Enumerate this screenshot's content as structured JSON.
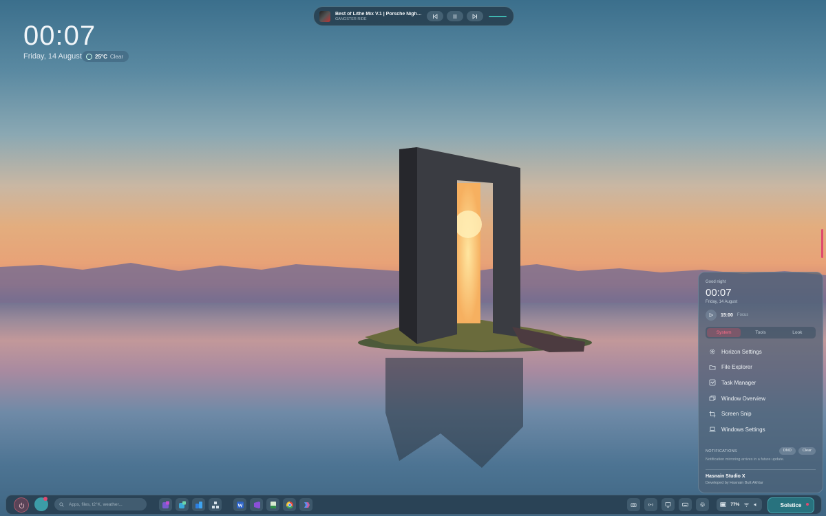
{
  "desktop": {
    "clock": "00:07",
    "date": "Friday, 14 August",
    "weather": {
      "temp": "25°C",
      "condition": "Clear"
    }
  },
  "media": {
    "title": "Best of Lithe Mix V.1 | Porsche Night R...",
    "artist": "GANGSTER RIDE",
    "controls": {
      "prev_icon": "skip-back-icon",
      "play_icon": "pause-icon",
      "next_icon": "skip-forward-icon"
    }
  },
  "panel": {
    "greeting": "Good night",
    "clock": "00:07",
    "date": "Friday, 14 August",
    "focus": {
      "time": "15:00",
      "label": "Focus"
    },
    "tabs": [
      {
        "label": "System",
        "active": true
      },
      {
        "label": "Tools",
        "active": false
      },
      {
        "label": "Look",
        "active": false
      }
    ],
    "menu": [
      {
        "label": "Horizon Settings",
        "icon": "gear-icon"
      },
      {
        "label": "File Explorer",
        "icon": "folder-icon"
      },
      {
        "label": "Task Manager",
        "icon": "activity-icon"
      },
      {
        "label": "Window Overview",
        "icon": "windows-stack-icon"
      },
      {
        "label": "Screen Snip",
        "icon": "crop-icon"
      },
      {
        "label": "Windows Settings",
        "icon": "laptop-icon"
      }
    ],
    "notifications": {
      "label": "NOTIFICATIONS",
      "dnd": "DND",
      "clear": "Clear",
      "info": "Notification mirroring arrives in a future update."
    },
    "footer": {
      "studio": "Hasnain Studio X",
      "developer": "Developed by Hasnain Butt Akhtar"
    }
  },
  "taskbar": {
    "search_placeholder": "Apps, files, t2°K, weather...",
    "apps": [
      "visual-studio-icon",
      "azure-data-studio-icon",
      "azure-icon",
      "network-tool-icon",
      "word-icon",
      "visual-studio-purple-icon",
      "excel-icon",
      "chrome-icon",
      "copilot-icon"
    ],
    "tray": [
      "camera-icon",
      "broadcast-icon",
      "monitor-icon",
      "keyboard-icon",
      "settings-icon"
    ],
    "battery": "77%",
    "start_label": "Solstice"
  },
  "colors": {
    "accent": "#3fb7b0",
    "alert": "#e04a70",
    "panel_bg": "#4c6074"
  }
}
